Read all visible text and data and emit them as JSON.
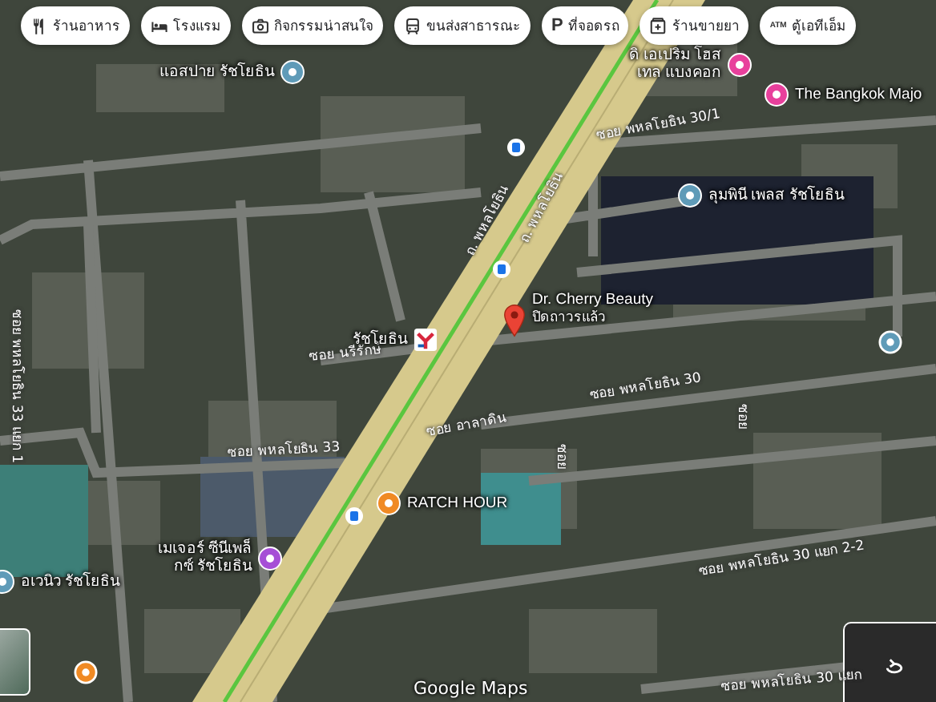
{
  "category_chips": [
    {
      "kind": "restaurant",
      "label": "ร้านอาหาร"
    },
    {
      "kind": "hotel",
      "label": "โรงแรม"
    },
    {
      "kind": "attraction",
      "label": "กิจกรรมน่าสนใจ"
    },
    {
      "kind": "transit",
      "label": "ขนส่งสาธารณะ"
    },
    {
      "kind": "parking",
      "badge": "P",
      "label": "ที่จอดรถ"
    },
    {
      "kind": "pharmacy",
      "label": "ร้านขายยา"
    },
    {
      "kind": "atm",
      "badge": "ATM",
      "label": "ตู้เอทีเอ็ม"
    }
  ],
  "places": [
    {
      "name": "แอสปาย รัชโยธิน",
      "kind": "circle",
      "color": "#5f9bb8"
    },
    {
      "name": "ดิ เอเปริม โฮสเทล แบงคอก",
      "kind": "circle",
      "color": "#e8409c"
    },
    {
      "name": "The Bangkok Majo",
      "kind": "circle",
      "color": "#e8409c"
    },
    {
      "name": "ลุมพินี เพลส รัชโยธิน",
      "kind": "circle",
      "color": "#5f9bb8"
    },
    {
      "name": "Dr. Cherry Beauty",
      "note": "ปิดถาวรแล้ว",
      "kind": "pin",
      "color": "#ea4335"
    },
    {
      "name": "รัชโยธิน",
      "kind": "station",
      "color": "#d7263d"
    },
    {
      "name": "RATCH HOUR",
      "kind": "circle",
      "color": "#f08a24"
    },
    {
      "name": "อเวนิว รัชโยธิน",
      "kind": "circle",
      "color": "#5f9bb8"
    },
    {
      "name": "เมเจอร์ ซีนีเพล็กซ์ รัชโยธิน",
      "kind": "circle",
      "color": "#a64fd6"
    }
  ],
  "road_labels": [
    {
      "label": "ถ. พหลโยธิน"
    },
    {
      "label": "ถ. พหลโยธิน"
    },
    {
      "label": "ซอย พหลโยธิน 30/1"
    },
    {
      "label": "ซอย นรีรักษ์"
    },
    {
      "label": "ซอย พหลโยธิน 30"
    },
    {
      "label": "ซอย อาลาดิน"
    },
    {
      "label": "ซอย พหลโยธิน 33"
    },
    {
      "label": "ซอย พหลโยธิน 33 แยก 1"
    },
    {
      "label": "ซอย พหลโยธิน 30 แยก 2-2"
    },
    {
      "label": "ซอย พหลโยธิน 30 แยก"
    },
    {
      "label": "ซอย"
    },
    {
      "label": "ซอย"
    }
  ],
  "attribution": "Google Maps"
}
